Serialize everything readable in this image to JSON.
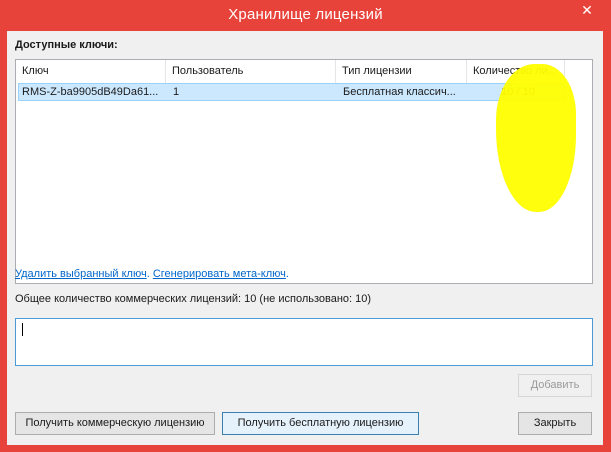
{
  "window": {
    "title": "Хранилище лицензий",
    "close_label": "✕"
  },
  "keys": {
    "label": "Доступные ключи:",
    "columns": [
      "Ключ",
      "Пользователь",
      "Тип лицензии",
      "Количество ли..."
    ],
    "rows": [
      [
        "RMS-Z-ba9905dB49Da61...",
        "1",
        "Бесплатная классич...",
        "10 / 10"
      ]
    ]
  },
  "links": {
    "delete": "Удалить выбранный ключ",
    "separator": ".",
    "generate": "Сгенерировать мета-ключ",
    "trailing": "."
  },
  "total_text": "Общее количество коммерческих лицензий: 10 (не использовано: 10)",
  "input": {
    "value": ""
  },
  "buttons": {
    "add": "Добавить",
    "get_commercial": "Получить коммерческую лицензию",
    "get_free": "Получить бесплатную лицензию",
    "close": "Закрыть"
  },
  "colors": {
    "window_frame": "#e8433b",
    "client_bg": "#f0f0f0",
    "selection": "#cce8ff",
    "link": "#0066cc",
    "highlight": "#ffff00"
  }
}
